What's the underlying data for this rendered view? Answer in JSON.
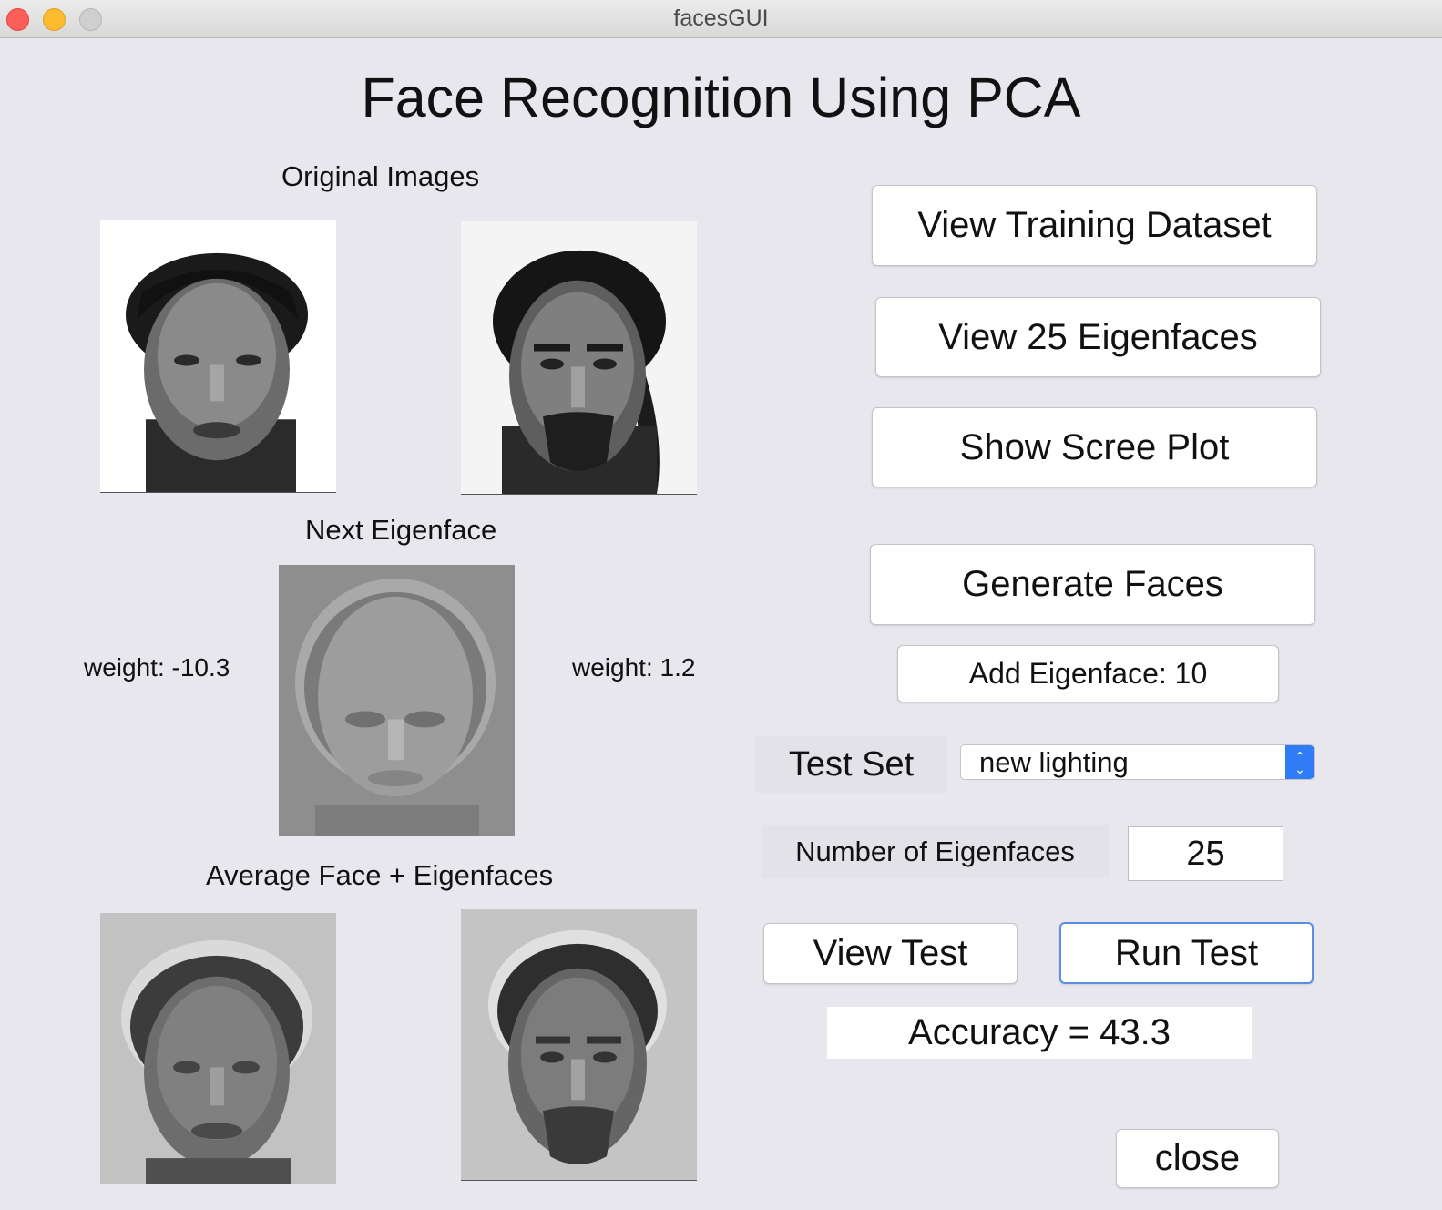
{
  "window": {
    "title": "facesGUI"
  },
  "page": {
    "title": "Face Recognition Using PCA"
  },
  "left": {
    "original_label": "Original Images",
    "next_eigenface_label": "Next Eigenface",
    "weight_left": "weight: -10.3",
    "weight_right": "weight: 1.2",
    "average_label": "Average Face + Eigenfaces"
  },
  "buttons": {
    "view_training": "View Training Dataset",
    "view_eigenfaces": "View 25 Eigenfaces",
    "scree_plot": "Show Scree Plot",
    "generate_faces": "Generate Faces",
    "add_eigenface": "Add Eigenface: 10",
    "view_test": "View Test",
    "run_test": "Run Test",
    "close": "close"
  },
  "test_set": {
    "label": "Test Set",
    "selected": "new lighting"
  },
  "num_eigenfaces": {
    "label": "Number of Eigenfaces",
    "value": "25"
  },
  "accuracy": {
    "text": "Accuracy = 43.3"
  },
  "icons": {
    "select_arrows": "chevron-up-down-icon"
  },
  "colors": {
    "background": "#e8e7ee",
    "select_accent": "#2f7cf6",
    "focus_ring": "#5b8fe6"
  }
}
